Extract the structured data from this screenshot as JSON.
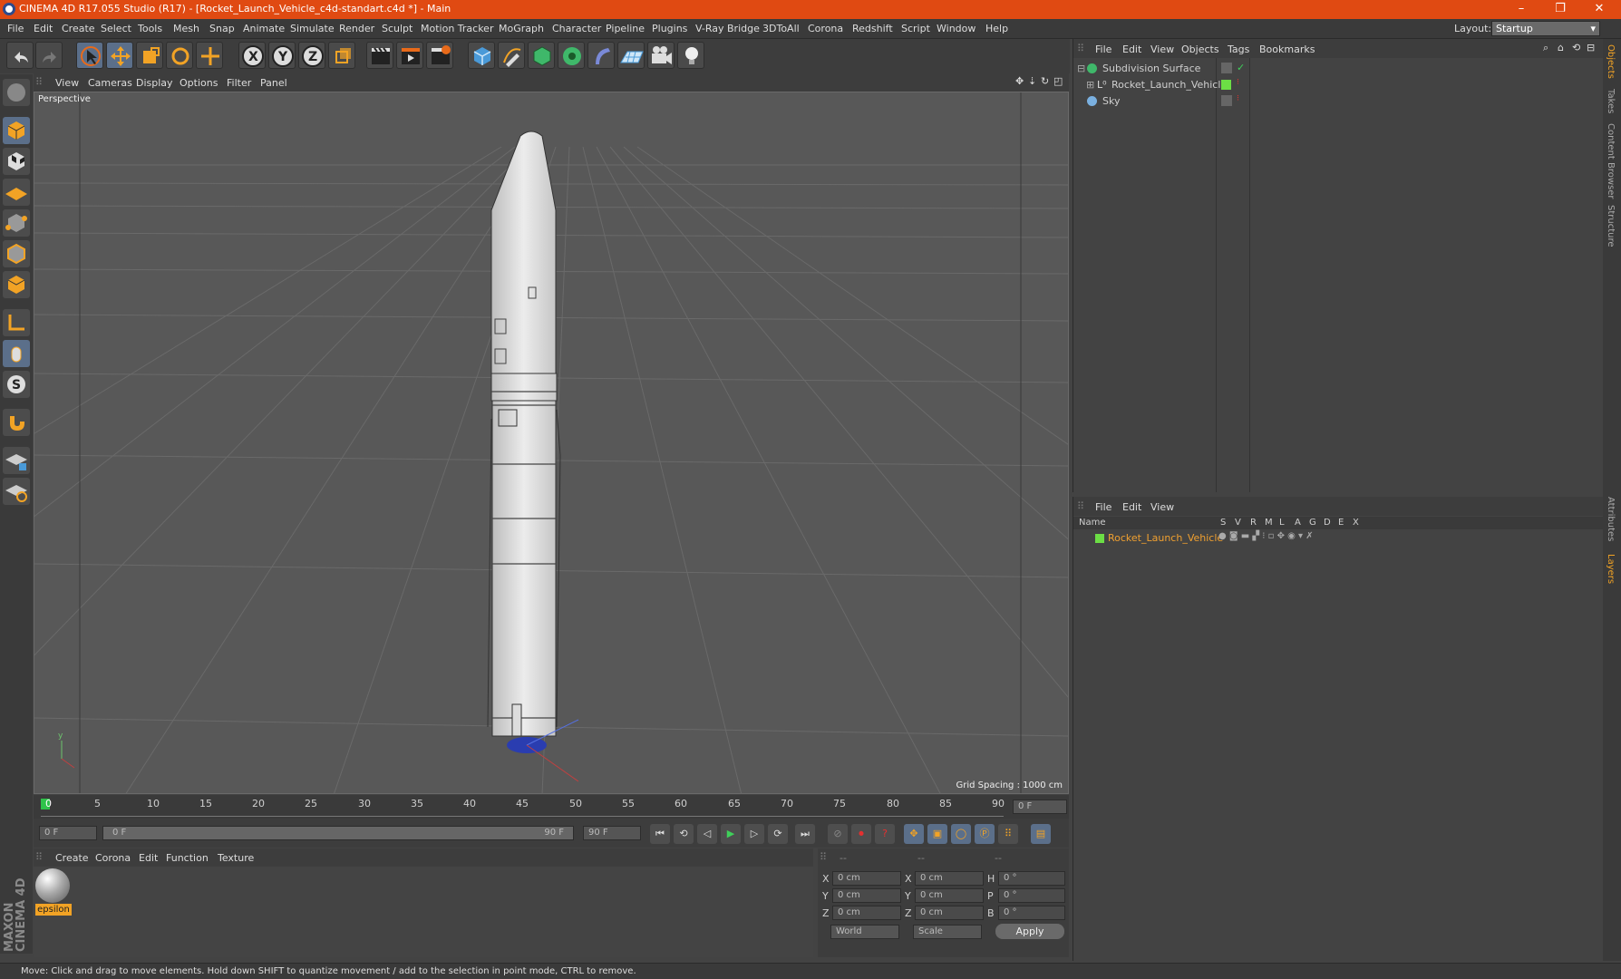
{
  "window": {
    "title": "CINEMA 4D R17.055 Studio (R17) - [Rocket_Launch_Vehicle_c4d-standart.c4d *] - Main",
    "min": "–",
    "max": "❐",
    "close": "✕"
  },
  "menu": [
    "File",
    "Edit",
    "Create",
    "Select",
    "Tools",
    "Mesh",
    "Snap",
    "Animate",
    "Simulate",
    "Render",
    "Sculpt",
    "Motion Tracker",
    "MoGraph",
    "Character",
    "Pipeline",
    "Plugins",
    "V-Ray Bridge",
    "3DToAll",
    "Corona",
    "Redshift",
    "Script",
    "Window",
    "Help"
  ],
  "layout": {
    "label": "Layout:",
    "value": "Startup"
  },
  "viewport": {
    "menu": [
      "View",
      "Cameras",
      "Display",
      "Options",
      "Filter",
      "Panel"
    ],
    "label": "Perspective",
    "grid_spacing": "Grid Spacing : 1000 cm"
  },
  "timeline": {
    "ticks": [
      "0",
      "5",
      "10",
      "15",
      "20",
      "25",
      "30",
      "35",
      "40",
      "45",
      "50",
      "55",
      "60",
      "65",
      "70",
      "75",
      "80",
      "85",
      "90"
    ],
    "frame_field": "0 F"
  },
  "controls": {
    "start": "0 F",
    "range_start": "0 F",
    "range_end": "90 F",
    "end": "90 F"
  },
  "material": {
    "menu": [
      "Create",
      "Corona",
      "Edit",
      "Function",
      "Texture"
    ],
    "name": "epsilon"
  },
  "coords": {
    "headers": [
      "--",
      "--",
      "--"
    ],
    "rows": [
      {
        "a": "X",
        "v1": "0 cm",
        "b": "X",
        "v2": "0 cm",
        "c": "H",
        "v3": "0 °"
      },
      {
        "a": "Y",
        "v1": "0 cm",
        "b": "Y",
        "v2": "0 cm",
        "c": "P",
        "v3": "0 °"
      },
      {
        "a": "Z",
        "v1": "0 cm",
        "b": "Z",
        "v2": "0 cm",
        "c": "B",
        "v3": "0 °"
      }
    ],
    "world": "World",
    "scale": "Scale",
    "apply": "Apply"
  },
  "objects": {
    "menu": [
      "File",
      "Edit",
      "View",
      "Objects",
      "Tags",
      "Bookmarks"
    ],
    "rows": [
      {
        "name": "Subdivision Surface"
      },
      {
        "name": "Rocket_Launch_Vehicle"
      },
      {
        "name": "Sky"
      }
    ]
  },
  "layers": {
    "menu": [
      "File",
      "Edit",
      "View"
    ],
    "columns": {
      "name": "Name",
      "flags": [
        "S",
        "V",
        "R",
        "M",
        "L",
        "A",
        "G",
        "D",
        "E",
        "X"
      ]
    },
    "rows": [
      {
        "name": "Rocket_Launch_Vehicle"
      }
    ]
  },
  "right_tabs": [
    "Objects",
    "Takes",
    "Content Browser",
    "Structure",
    "Attributes",
    "Layers"
  ],
  "brand": "MAXON CINEMA 4D",
  "status": "Move: Click and drag to move elements. Hold down SHIFT to quantize movement / add to the selection in point mode, CTRL to remove."
}
